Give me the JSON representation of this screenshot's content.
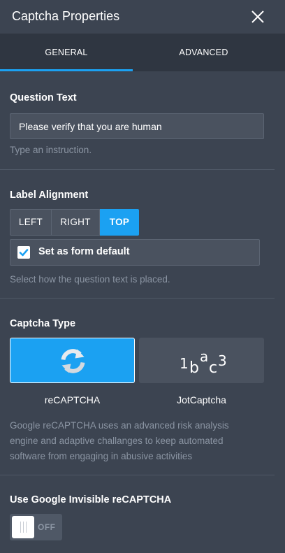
{
  "header": {
    "title": "Captcha Properties",
    "close_icon": "close-icon"
  },
  "tabs": [
    {
      "label": "GENERAL",
      "active": true
    },
    {
      "label": "ADVANCED",
      "active": false
    }
  ],
  "question_text": {
    "label": "Question Text",
    "value": "Please verify that you are human",
    "help": "Type an instruction."
  },
  "label_alignment": {
    "label": "Label Alignment",
    "options": [
      "LEFT",
      "RIGHT",
      "TOP"
    ],
    "selected": "TOP",
    "default_checkbox_label": "Set as form default",
    "default_checked": true,
    "help": "Select how the question text is placed."
  },
  "captcha_type": {
    "label": "Captcha Type",
    "options": [
      {
        "name": "reCAPTCHA",
        "icon": "recaptcha-icon",
        "selected": true
      },
      {
        "name": "JotCaptcha",
        "icon": "jotcaptcha-icon",
        "selected": false
      }
    ],
    "help": "Google reCAPTCHA uses an advanced risk analysis engine and adaptive challanges to keep automated software from engaging in abusive activities"
  },
  "invisible_recaptcha": {
    "label": "Use Google Invisible reCAPTCHA",
    "toggle_state": "OFF"
  },
  "colors": {
    "background": "#3c4451",
    "tab_bar": "#2f3641",
    "accent": "#1ba1f2",
    "field": "#4a525f",
    "muted_text": "#8b95a3"
  }
}
